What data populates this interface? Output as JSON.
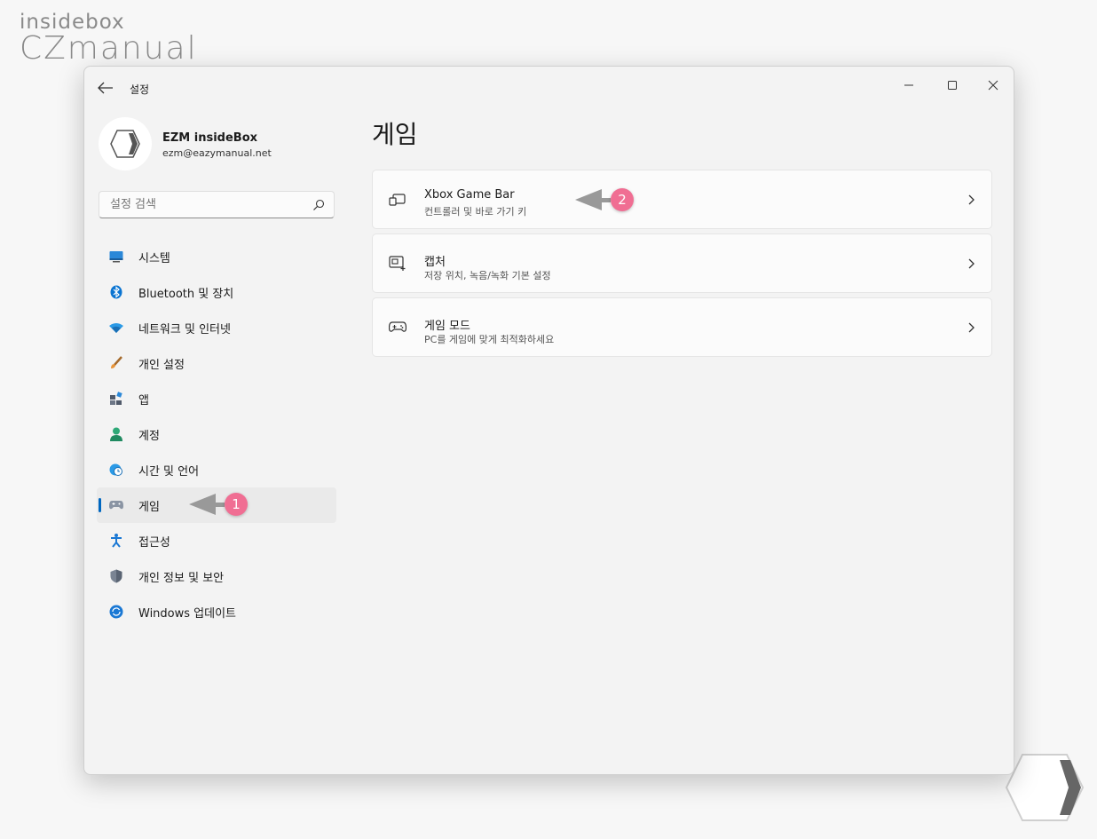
{
  "watermark": {
    "line1": "insidebox",
    "line2": "CZmanual"
  },
  "window": {
    "title": "설정",
    "controls": {
      "minimize": "minimize-icon",
      "maximize": "maximize-icon",
      "close": "close-icon"
    }
  },
  "user": {
    "name": "EZM insideBox",
    "email": "ezm@eazymanual.net"
  },
  "search": {
    "placeholder": "설정 검색",
    "icon": "search-icon"
  },
  "sidebar": {
    "items": [
      {
        "label": "시스템",
        "icon": "system-icon",
        "active": false
      },
      {
        "label": "Bluetooth 및 장치",
        "icon": "bluetooth-icon",
        "active": false
      },
      {
        "label": "네트워크 및 인터넷",
        "icon": "wifi-icon",
        "active": false
      },
      {
        "label": "개인 설정",
        "icon": "paint-brush-icon",
        "active": false
      },
      {
        "label": "앱",
        "icon": "apps-icon",
        "active": false
      },
      {
        "label": "계정",
        "icon": "account-icon",
        "active": false
      },
      {
        "label": "시간 및 언어",
        "icon": "time-language-icon",
        "active": false
      },
      {
        "label": "게임",
        "icon": "gamepad-icon",
        "active": true
      },
      {
        "label": "접근성",
        "icon": "accessibility-icon",
        "active": false
      },
      {
        "label": "개인 정보 및 보안",
        "icon": "shield-icon",
        "active": false
      },
      {
        "label": "Windows 업데이트",
        "icon": "update-icon",
        "active": false
      }
    ]
  },
  "main": {
    "title": "게임",
    "cards": [
      {
        "title": "Xbox Game Bar",
        "subtitle": "컨트롤러 및 바로 가기 키",
        "icon": "game-bar-icon"
      },
      {
        "title": "캡처",
        "subtitle": "저장 위치, 녹음/녹화 기본 설정",
        "icon": "capture-icon"
      },
      {
        "title": "게임 모드",
        "subtitle": "PC를 게임에 맞게 최적화하세요",
        "icon": "game-mode-icon"
      }
    ]
  },
  "annotations": {
    "step1": "1",
    "step2": "2"
  },
  "colors": {
    "accent": "#0067c0",
    "badge": "#f06e93",
    "arrow": "#999999"
  }
}
